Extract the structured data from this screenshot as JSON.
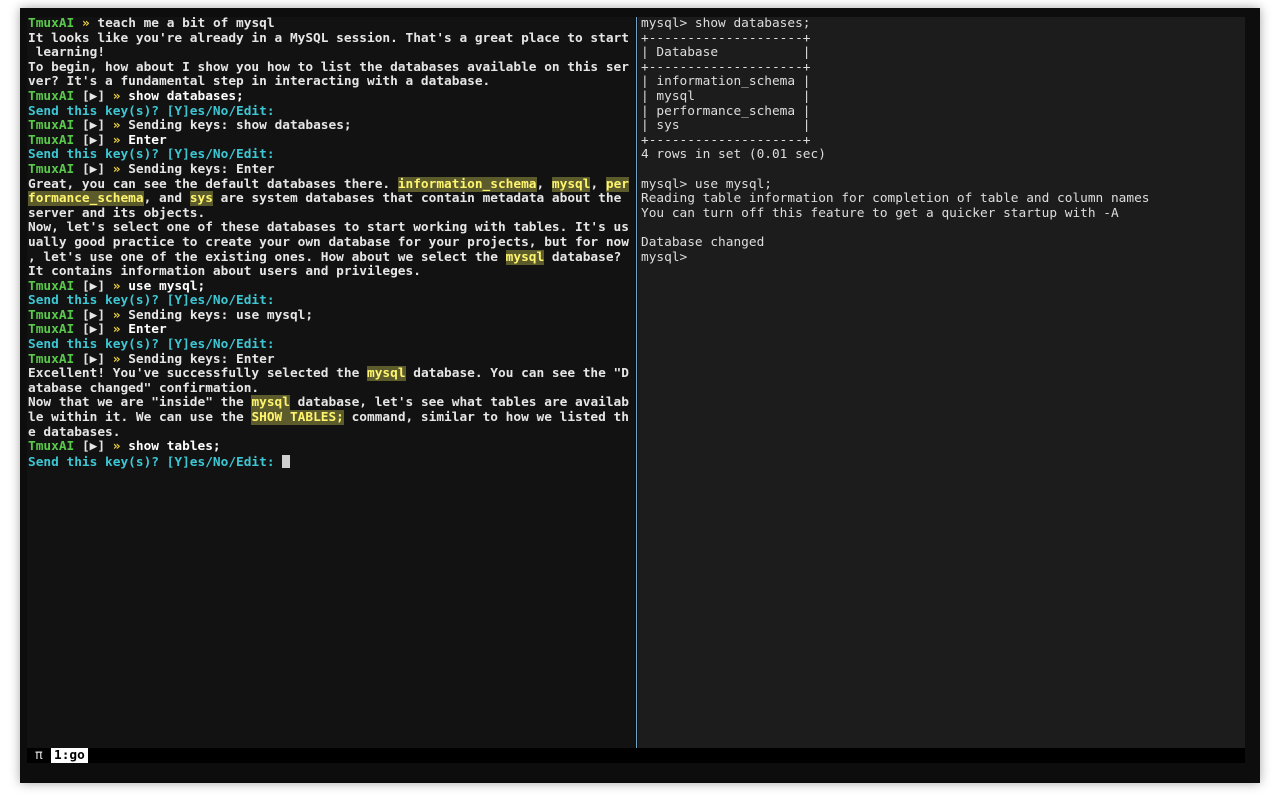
{
  "left_pane": {
    "lines": [
      [
        {
          "t": "TmuxAI",
          "c": "ai"
        },
        {
          "t": " "
        },
        {
          "t": "»",
          "c": "arrow"
        },
        {
          "t": " teach me a bit of mysql"
        }
      ],
      [
        {
          "t": "It looks like you're already in a MySQL session. That's a great place to start"
        }
      ],
      [
        {
          "t": " learning!"
        }
      ],
      [
        {
          "t": "To begin, how about I show you how to list the databases available on this ser"
        }
      ],
      [
        {
          "t": "ver? It's a fundamental step in interacting with a database."
        }
      ],
      [
        {
          "t": "TmuxAI",
          "c": "ai"
        },
        {
          "t": " [▶] "
        },
        {
          "t": "»",
          "c": "arrow"
        },
        {
          "t": " show databases;",
          "c": "cmd"
        }
      ],
      [
        {
          "t": "Send this key(s)? [Y]es/No/Edit:",
          "c": "prompt"
        }
      ],
      [
        {
          "t": "TmuxAI",
          "c": "ai"
        },
        {
          "t": " [▶] "
        },
        {
          "t": "»",
          "c": "arrow"
        },
        {
          "t": " Sending keys: show databases;"
        }
      ],
      [
        {
          "t": "TmuxAI",
          "c": "ai"
        },
        {
          "t": " [▶] "
        },
        {
          "t": "»",
          "c": "arrow"
        },
        {
          "t": " Enter",
          "c": "cmd"
        }
      ],
      [
        {
          "t": "Send this key(s)? [Y]es/No/Edit:",
          "c": "prompt"
        }
      ],
      [
        {
          "t": "TmuxAI",
          "c": "ai"
        },
        {
          "t": " [▶] "
        },
        {
          "t": "»",
          "c": "arrow"
        },
        {
          "t": " Sending keys: Enter"
        }
      ],
      [
        {
          "t": "Great, you can see the default databases there. "
        },
        {
          "t": "information_schema",
          "c": "hl"
        },
        {
          "t": ", "
        },
        {
          "t": "mysql",
          "c": "hl"
        },
        {
          "t": ", "
        },
        {
          "t": "per",
          "c": "hl"
        }
      ],
      [
        {
          "t": "formance_schema",
          "c": "hl"
        },
        {
          "t": ", and "
        },
        {
          "t": "sys",
          "c": "hl"
        },
        {
          "t": " are system databases that contain metadata about the"
        }
      ],
      [
        {
          "t": "server and its objects."
        }
      ],
      [
        {
          "t": "Now, let's select one of these databases to start working with tables. It's us"
        }
      ],
      [
        {
          "t": "ually good practice to create your own database for your projects, but for now"
        }
      ],
      [
        {
          "t": ", let's use one of the existing ones. How about we select the "
        },
        {
          "t": "mysql",
          "c": "hl"
        },
        {
          "t": " database?"
        }
      ],
      [
        {
          "t": "It contains information about users and privileges."
        }
      ],
      [
        {
          "t": "TmuxAI",
          "c": "ai"
        },
        {
          "t": " [▶] "
        },
        {
          "t": "»",
          "c": "arrow"
        },
        {
          "t": " use mysql;",
          "c": "cmd"
        }
      ],
      [
        {
          "t": "Send this key(s)? [Y]es/No/Edit:",
          "c": "prompt"
        }
      ],
      [
        {
          "t": "TmuxAI",
          "c": "ai"
        },
        {
          "t": " [▶] "
        },
        {
          "t": "»",
          "c": "arrow"
        },
        {
          "t": " Sending keys: use mysql;"
        }
      ],
      [
        {
          "t": "TmuxAI",
          "c": "ai"
        },
        {
          "t": " [▶] "
        },
        {
          "t": "»",
          "c": "arrow"
        },
        {
          "t": " Enter",
          "c": "cmd"
        }
      ],
      [
        {
          "t": "Send this key(s)? [Y]es/No/Edit:",
          "c": "prompt"
        }
      ],
      [
        {
          "t": "TmuxAI",
          "c": "ai"
        },
        {
          "t": " [▶] "
        },
        {
          "t": "»",
          "c": "arrow"
        },
        {
          "t": " Sending keys: Enter"
        }
      ],
      [
        {
          "t": "Excellent! You've successfully selected the "
        },
        {
          "t": "mysql",
          "c": "hl"
        },
        {
          "t": " database. You can see the \"D"
        }
      ],
      [
        {
          "t": "atabase changed\" confirmation."
        }
      ],
      [
        {
          "t": "Now that we are \"inside\" the "
        },
        {
          "t": "mysql",
          "c": "hl"
        },
        {
          "t": " database, let's see what tables are availab"
        }
      ],
      [
        {
          "t": "le within it. We can use the "
        },
        {
          "t": "SHOW TABLES;",
          "c": "hl"
        },
        {
          "t": " command, similar to how we listed th"
        }
      ],
      [
        {
          "t": "e databases."
        }
      ],
      [
        {
          "t": "TmuxAI",
          "c": "ai"
        },
        {
          "t": " [▶] "
        },
        {
          "t": "»",
          "c": "arrow"
        },
        {
          "t": " show tables;",
          "c": "cmd"
        }
      ],
      [
        {
          "t": "Send this key(s)? [Y]es/No/Edit: ",
          "c": "prompt"
        },
        {
          "t": "",
          "c": "cursor"
        }
      ]
    ]
  },
  "right_pane": {
    "lines": [
      "mysql> show databases;",
      "+--------------------+",
      "| Database           |",
      "+--------------------+",
      "| information_schema |",
      "| mysql              |",
      "| performance_schema |",
      "| sys                |",
      "+--------------------+",
      "4 rows in set (0.01 sec)",
      "",
      "mysql> use mysql;",
      "Reading table information for completion of table and column names",
      "You can turn off this feature to get a quicker startup with -A",
      "",
      "Database changed",
      "mysql> "
    ]
  },
  "statusbar": {
    "session_glyph": "π",
    "window_tab": "1:go"
  },
  "colors": {
    "ai_label": "#59c94b",
    "arrow": "#f2d43e",
    "prompt": "#3dc7d3",
    "highlight_bg": "#5b5b2c",
    "highlight_fg": "#fff46e",
    "divider": "#6ea6c9"
  }
}
